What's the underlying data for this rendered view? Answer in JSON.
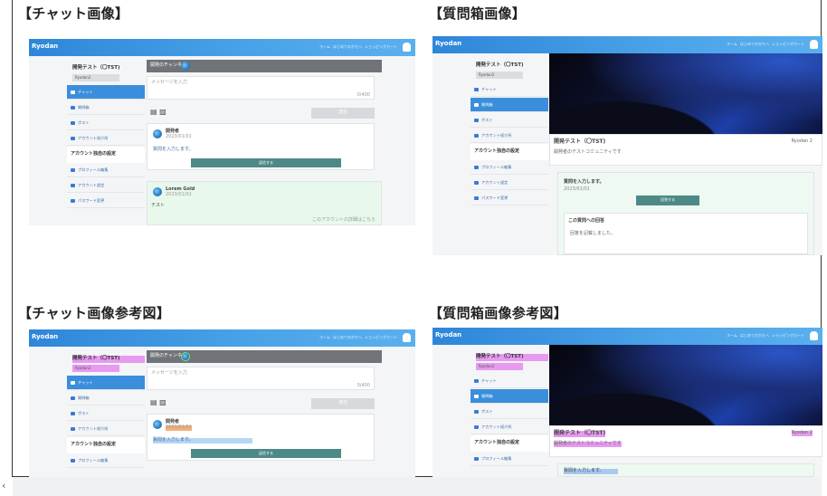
{
  "headings": {
    "chat": "【チャット画像】",
    "question": "【質問箱画像】",
    "chat_ref": "【チャット画像参考図】",
    "question_ref": "【質問箱画像参考図】"
  },
  "app": {
    "logo": "Ryodan",
    "nav": [
      "ホーム",
      "はじめてのかたへ",
      "ショッピングカート"
    ]
  },
  "sidebar": {
    "profile_name": "開発テスト（〇TST)",
    "tag": "Ryodan2",
    "items": [
      "チャット",
      "質問箱",
      "ポスト",
      "アカウント紹介所"
    ],
    "section": "アカウント独自の設定",
    "settings": [
      "プロフィール編集",
      "アカウント設定",
      "パスワード変更"
    ]
  },
  "chat": {
    "header": "開発のチャンネル",
    "input_placeholder": "メッセージを入力",
    "counter": "0/400",
    "send": "送信",
    "poster": "開発者",
    "poster_date": "2023/01/01",
    "message": "質問を入力します。",
    "reply_button": "返信する",
    "user2": "Lorem Gold",
    "user2_date": "2023/01/01",
    "msg2": "テスト",
    "footer_links": "このアカウントの詳細はこちら"
  },
  "question": {
    "title": "開発テスト（〇TST)",
    "tag": "Ryodan 2",
    "desc": "開発者のテストコミュニティです",
    "question_text": "質問を入力します。",
    "question_date": "2023/01/01",
    "reply_button": "回答する",
    "history_title": "この質問への回答",
    "answer": "回答を記載しました。"
  }
}
